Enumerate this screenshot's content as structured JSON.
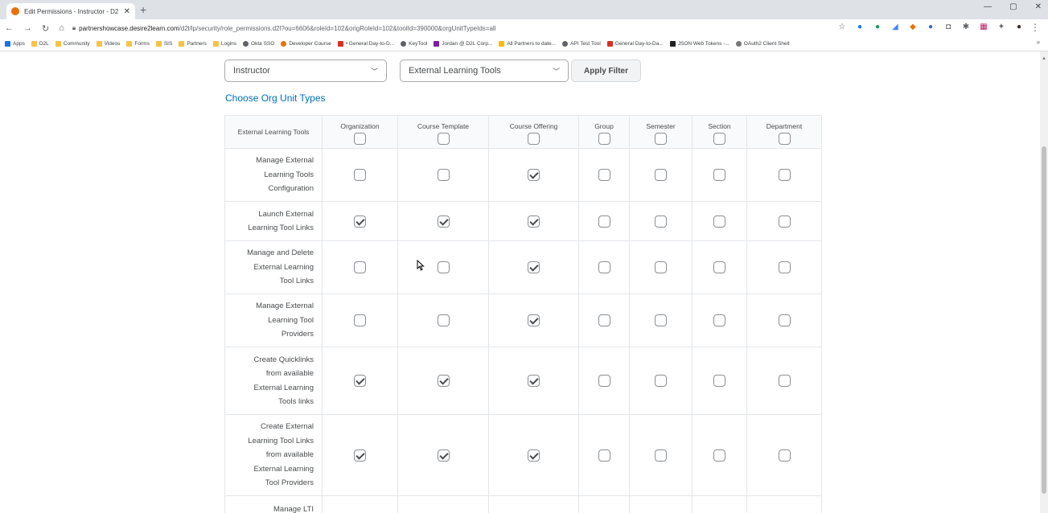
{
  "browser": {
    "tab_title": "Edit Permissions - Instructor - D2",
    "url_host": "partnershowcase.desire2learn.com",
    "url_path": "/d2l/lp/security/role_permissions.d2l?ou=6606&roleId=102&origRoleId=102&toolId=390000&orgUnitTypeIds=all",
    "bookmarks": [
      "Apps",
      "D2L",
      "Community",
      "Videos",
      "Forms",
      "SIS",
      "Partners",
      "Logins",
      "Okta SSO",
      "Developer Course",
      "• General Day-to-D...",
      "KeyTool",
      "Jordan @ D2L Corp...",
      "All Partners to date...",
      "API Test Tool",
      "General Day-to-Da...",
      "JSON Web Tokens -...",
      "OAuth2 Client Shell"
    ],
    "more_bookmarks": "»"
  },
  "filters": {
    "role_select": "Instructor",
    "tool_select": "External Learning Tools",
    "apply_label": "Apply Filter"
  },
  "choose_link": "Choose Org Unit Types",
  "table": {
    "corner_header": "External Learning Tools",
    "columns": [
      "Organization",
      "Course Template",
      "Course Offering",
      "Group",
      "Semester",
      "Section",
      "Department"
    ],
    "rows": [
      {
        "lines": [
          "Manage External",
          "Learning Tools",
          "Configuration"
        ],
        "checks": [
          false,
          false,
          true,
          false,
          false,
          false,
          false
        ]
      },
      {
        "lines": [
          "Launch External",
          "Learning Tool Links"
        ],
        "checks": [
          true,
          true,
          true,
          false,
          false,
          false,
          false
        ]
      },
      {
        "lines": [
          "Manage and Delete",
          "External Learning",
          "Tool Links"
        ],
        "checks": [
          false,
          false,
          true,
          false,
          false,
          false,
          false
        ]
      },
      {
        "lines": [
          "Manage External",
          "Learning Tool",
          "Providers"
        ],
        "checks": [
          false,
          false,
          true,
          false,
          false,
          false,
          false
        ]
      },
      {
        "lines": [
          "Create Quicklinks",
          "from available",
          "External Learning",
          "Tools links"
        ],
        "checks": [
          true,
          true,
          true,
          false,
          false,
          false,
          false
        ]
      },
      {
        "lines": [
          "Create External",
          "Learning Tool Links",
          "from available",
          "External Learning",
          "Tool Providers"
        ],
        "checks": [
          true,
          true,
          true,
          false,
          false,
          false,
          false
        ]
      },
      {
        "lines": [
          "Manage LTI"
        ],
        "checks": null
      }
    ]
  }
}
